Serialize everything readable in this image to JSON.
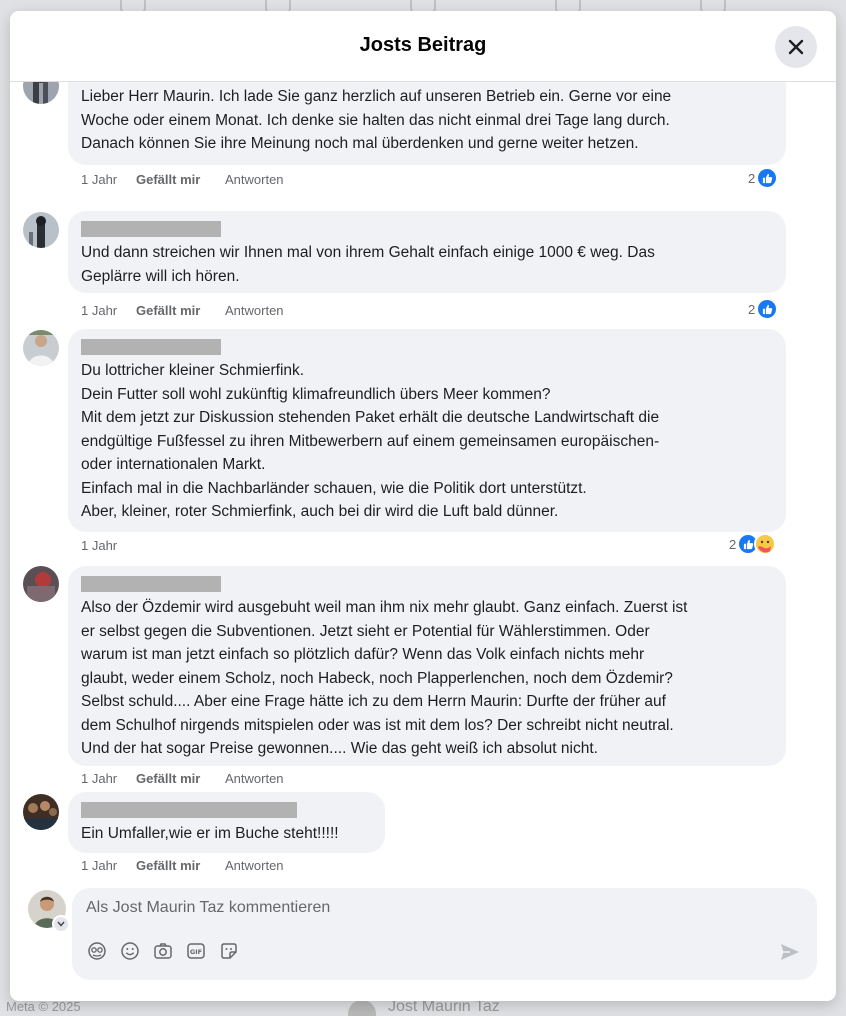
{
  "dialog": {
    "title": "Josts Beitrag",
    "close_icon": "close-icon"
  },
  "comments": [
    {
      "text": "Lieber Herr Maurin. Ich lade Sie ganz herzlich auf unseren Betrieb ein. Gerne vor eine\nWoche oder einem Monat. Ich denke sie halten das nicht einmal drei Tage lang durch.\nDanach können Sie ihre Meinung noch mal überdenken und gerne weiter hetzen.",
      "time": "1 Jahr",
      "like_label": "Gefällt mir",
      "reply_label": "Antworten",
      "reaction_count": "2",
      "reactions": [
        "like"
      ]
    },
    {
      "text": "Und dann streichen wir Ihnen mal von ihrem Gehalt einfach einige 1000 € weg. Das\nGeplärre will ich hören.",
      "time": "1 Jahr",
      "like_label": "Gefällt mir",
      "reply_label": "Antworten",
      "reaction_count": "2",
      "reactions": [
        "like"
      ]
    },
    {
      "text": "Du lottricher kleiner Schmierfink.\nDein Futter soll wohl zukünftig klimafreundlich übers Meer kommen?\nMit dem jetzt zur Diskussion stehenden Paket erhält die deutsche Landwirtschaft die\nendgültige Fußfessel zu ihren Mitbewerbern auf einem gemeinsamen europäischen-\noder internationalen Markt.\nEinfach mal in die Nachbarländer schauen, wie die Politik dort unterstützt.\nAber, kleiner, roter Schmierfink, auch bei dir wird die Luft bald dünner.",
      "time": "1 Jahr",
      "reaction_count": "2",
      "reactions": [
        "like",
        "care"
      ]
    },
    {
      "text": "Also der Özdemir wird ausgebuht weil man ihm nix mehr glaubt. Ganz einfach. Zuerst ist\ner selbst gegen die Subventionen. Jetzt sieht er Potential für Wählerstimmen. Oder\nwarum ist man jetzt einfach so plötzlich dafür? Wenn das Volk einfach nichts mehr\nglaubt, weder einem Scholz, noch Habeck, noch Plapperlenchen, noch dem Özdemir?\nSelbst schuld.... Aber eine Frage hätte ich zu dem Herrn Maurin: Durfte der früher auf\ndem Schulhof nirgends mitspielen oder was ist mit dem los? Der schreibt nicht neutral.\nUnd der hat sogar Preise gewonnen.... Wie das geht weiß ich absolut nicht.",
      "time": "1 Jahr",
      "like_label": "Gefällt mir",
      "reply_label": "Antworten"
    },
    {
      "text": "Ein Umfaller,wie er im Buche steht!!!!!",
      "time": "1 Jahr",
      "like_label": "Gefällt mir",
      "reply_label": "Antworten"
    }
  ],
  "composer": {
    "placeholder": "Als Jost Maurin Taz kommentieren",
    "tools": [
      "avatar-sticker-icon",
      "emoji-icon",
      "camera-icon",
      "gif-icon",
      "sticker-icon"
    ],
    "send_icon": "send-icon"
  },
  "background": {
    "footer_meta": "Meta © 2025",
    "footer_name": "Jost Maurin Taz"
  },
  "colors": {
    "like_blue": "#1877f2",
    "bubble_gray": "#f0f2f5",
    "secondary_text": "#65676b"
  }
}
